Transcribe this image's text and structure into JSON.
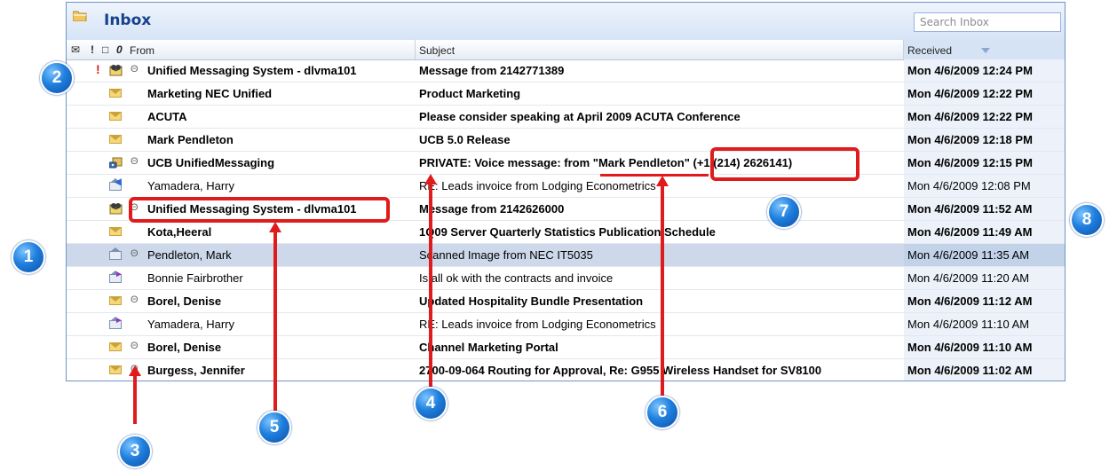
{
  "folder": {
    "title": "Inbox",
    "search_placeholder": "Search Inbox"
  },
  "columns": {
    "from": "From",
    "subject": "Subject",
    "received": "Received"
  },
  "messages": [
    {
      "from": "Unified Messaging System - dlvma101",
      "subject": "Message from 2142771389",
      "received": "Mon 4/6/2009 12:24 PM",
      "unread": true,
      "important": true,
      "icon": "voicemail-icon",
      "attachment": true
    },
    {
      "from": "Marketing NEC Unified",
      "subject": "Product Marketing",
      "received": "Mon 4/6/2009 12:22 PM",
      "unread": true,
      "important": false,
      "icon": "envelope-icon",
      "attachment": false
    },
    {
      "from": "ACUTA",
      "subject": "Please consider speaking at April 2009 ACUTA Conference",
      "received": "Mon 4/6/2009 12:22 PM",
      "unread": true,
      "important": false,
      "icon": "envelope-icon",
      "attachment": false
    },
    {
      "from": "Mark Pendleton",
      "subject": "UCB 5.0 Release",
      "received": "Mon 4/6/2009 12:18 PM",
      "unread": true,
      "important": false,
      "icon": "envelope-icon",
      "attachment": false
    },
    {
      "from": "UCB UnifiedMessaging",
      "subject": "PRIVATE: Voice message: from \"Mark Pendleton\" (+1 (214) 2626141)",
      "received": "Mon 4/6/2009 12:15 PM",
      "unread": true,
      "important": false,
      "icon": "private-voicemail-icon",
      "attachment": true
    },
    {
      "from": "Yamadera, Harry",
      "subject": "RE: Leads invoice from Lodging Econometrics",
      "received": "Mon 4/6/2009 12:08 PM",
      "unread": false,
      "important": false,
      "icon": "replied-icon",
      "attachment": false
    },
    {
      "from": "Unified Messaging System - dlvma101",
      "subject": "Message from 2142626000",
      "received": "Mon 4/6/2009 11:52 AM",
      "unread": true,
      "important": false,
      "icon": "voicemail-icon",
      "attachment": true
    },
    {
      "from": "Kota,Heeral",
      "subject": "1Q09 Server Quarterly Statistics Publication Schedule",
      "received": "Mon 4/6/2009 11:49 AM",
      "unread": true,
      "important": false,
      "icon": "envelope-icon",
      "attachment": false
    },
    {
      "from": "Pendleton, Mark",
      "subject": "Scanned Image from NEC IT5035",
      "received": "Mon 4/6/2009 11:35 AM",
      "unread": false,
      "important": false,
      "icon": "read-envelope-icon",
      "attachment": true,
      "selected": true
    },
    {
      "from": "Bonnie Fairbrother",
      "subject": "Is all ok with the contracts and invoice",
      "received": "Mon 4/6/2009 11:20 AM",
      "unread": false,
      "important": false,
      "icon": "forwarded-icon",
      "attachment": false
    },
    {
      "from": "Borel, Denise",
      "subject": "Updated Hospitality Bundle Presentation",
      "received": "Mon 4/6/2009 11:12 AM",
      "unread": true,
      "important": false,
      "icon": "envelope-icon",
      "attachment": true
    },
    {
      "from": "Yamadera, Harry",
      "subject": "RE: Leads invoice from Lodging Econometrics",
      "received": "Mon 4/6/2009 11:10 AM",
      "unread": false,
      "important": false,
      "icon": "forwarded-icon",
      "attachment": false
    },
    {
      "from": "Borel, Denise",
      "subject": "Channel Marketing Portal",
      "received": "Mon 4/6/2009 11:10 AM",
      "unread": true,
      "important": false,
      "icon": "envelope-icon",
      "attachment": true
    },
    {
      "from": "Burgess, Jennifer",
      "subject": "2700-09-064 Routing for Approval, Re: G955 Wireless Handset for SV8100",
      "received": "Mon 4/6/2009 11:02 AM",
      "unread": true,
      "important": false,
      "icon": "envelope-icon",
      "attachment": true
    }
  ],
  "annotations": [
    "1",
    "2",
    "3",
    "4",
    "5",
    "6",
    "7",
    "8"
  ],
  "colors": {
    "annotation_red": "#e01b1b",
    "badge_blue": "#1f7fdd",
    "header_text": "#15428b"
  }
}
